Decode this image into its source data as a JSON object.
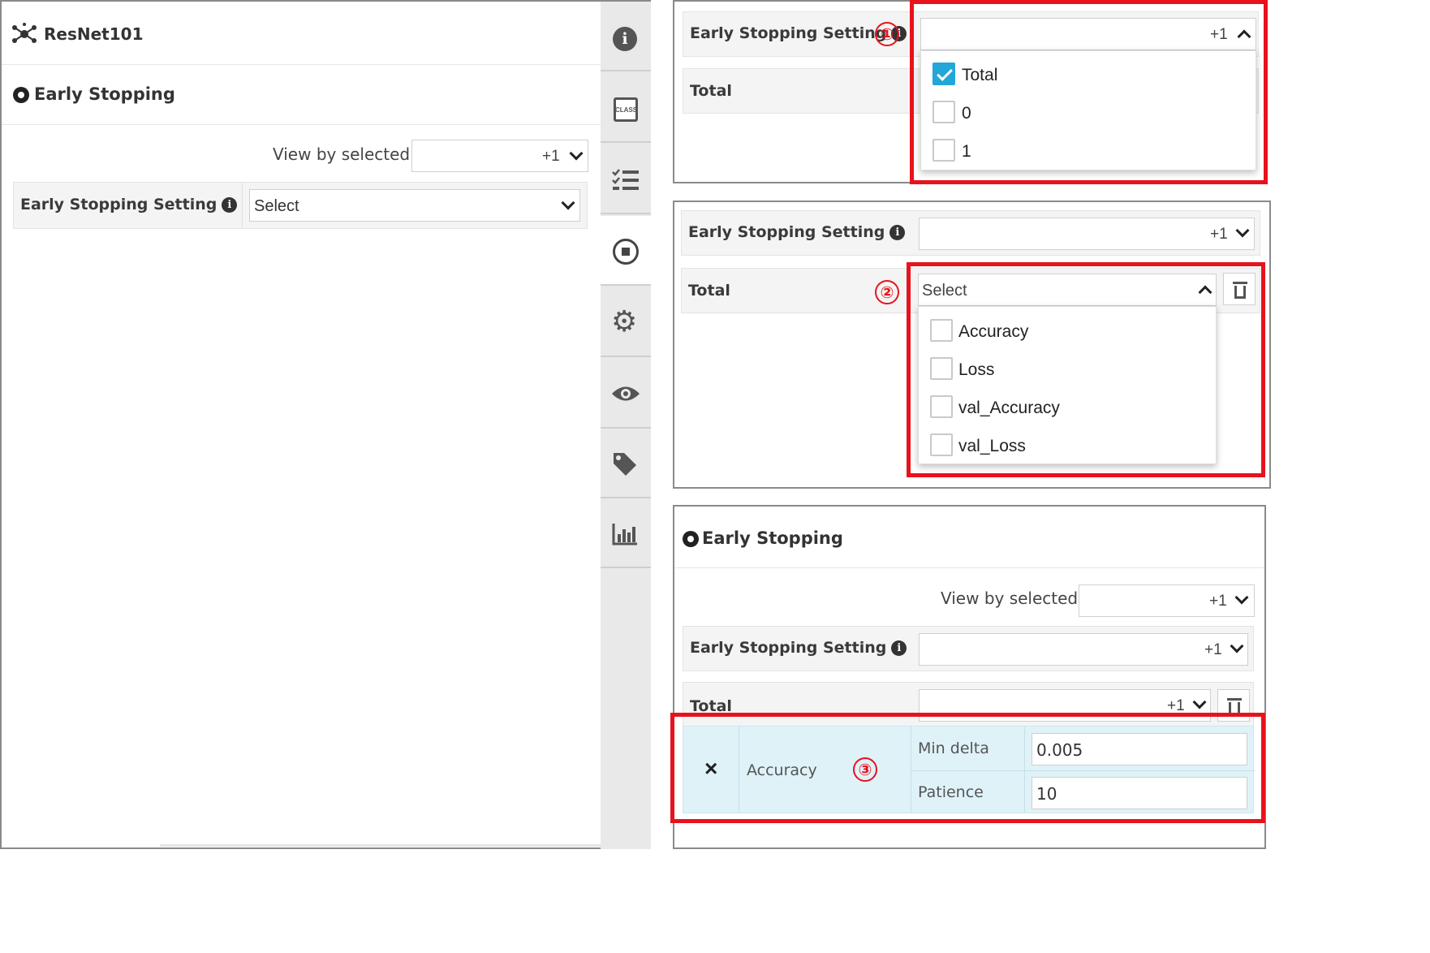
{
  "left": {
    "app_title": "ResNet101",
    "section_title": "Early Stopping",
    "view_by_label": "View by selected :",
    "view_by_value": "+1",
    "es_setting_label": "Early Stopping Setting",
    "es_setting_select": "Select"
  },
  "sidebar": {
    "icons": [
      "info-icon",
      "class-icon",
      "checklist-icon",
      "stop-icon",
      "gear-icon",
      "eye-icon",
      "tag-icon",
      "chart-icon"
    ],
    "class_text": "CLASS"
  },
  "step1": {
    "marker": "①",
    "es_setting_label": "Early Stopping Setting",
    "select_value": "+1",
    "total_label": "Total",
    "options": [
      {
        "label": "Total",
        "checked": true
      },
      {
        "label": "0",
        "checked": false
      },
      {
        "label": "1",
        "checked": false
      }
    ]
  },
  "step2": {
    "marker": "②",
    "es_setting_label": "Early Stopping Setting",
    "select_value": "+1",
    "total_label": "Total",
    "total_select": "Select",
    "options": [
      "Accuracy",
      "Loss",
      "val_Accuracy",
      "val_Loss"
    ]
  },
  "step3": {
    "marker": "③",
    "section_title": "Early Stopping",
    "view_by_label": "View by selected :",
    "view_by_value": "+1",
    "es_setting_label": "Early Stopping Setting",
    "es_setting_value": "+1",
    "total_label": "Total",
    "total_value": "+1",
    "remove_symbol": "×",
    "metric": "Accuracy",
    "min_delta_label": "Min delta",
    "min_delta_value": "0.005",
    "patience_label": "Patience",
    "patience_value": "10"
  },
  "colors": {
    "accent": "#23a7d9",
    "highlight": "#e8121c",
    "selected_row": "#dff2f8"
  }
}
